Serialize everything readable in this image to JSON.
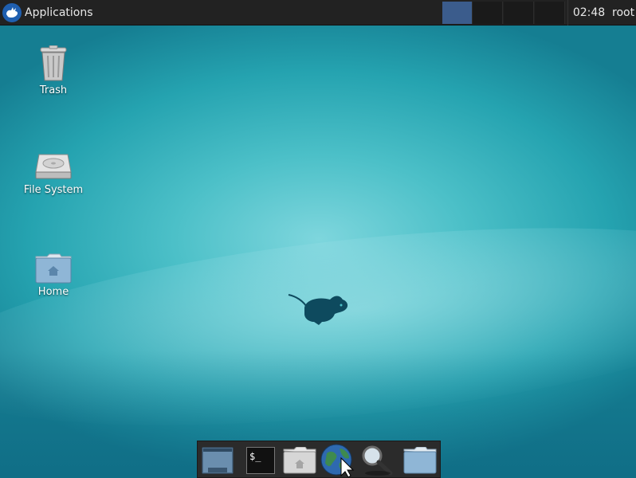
{
  "panel": {
    "applications_label": "Applications",
    "clock": "02:48",
    "user": "root",
    "workspaces": [
      {
        "name": "workspace-1",
        "active": true
      },
      {
        "name": "workspace-2",
        "active": false
      },
      {
        "name": "workspace-3",
        "active": false
      },
      {
        "name": "workspace-4",
        "active": false
      }
    ]
  },
  "desktop": {
    "icons": [
      {
        "label": "Trash",
        "icon": "trash-icon"
      },
      {
        "label": "File System",
        "icon": "drive-icon"
      },
      {
        "label": "Home",
        "icon": "home-folder-icon"
      }
    ]
  },
  "dock": {
    "items": [
      {
        "icon": "show-desktop-icon"
      },
      {
        "icon": "terminal-icon",
        "text": "$_"
      },
      {
        "icon": "home-folder-icon"
      },
      {
        "icon": "web-browser-icon"
      },
      {
        "icon": "search-magnifier-icon"
      },
      {
        "icon": "folder-icon"
      }
    ]
  },
  "colors": {
    "panel_bg": "#222222",
    "active_workspace": "#3b5c8c",
    "xfce_blue": "#1f5fb0",
    "mouse_logo": "#0e4a5e"
  }
}
